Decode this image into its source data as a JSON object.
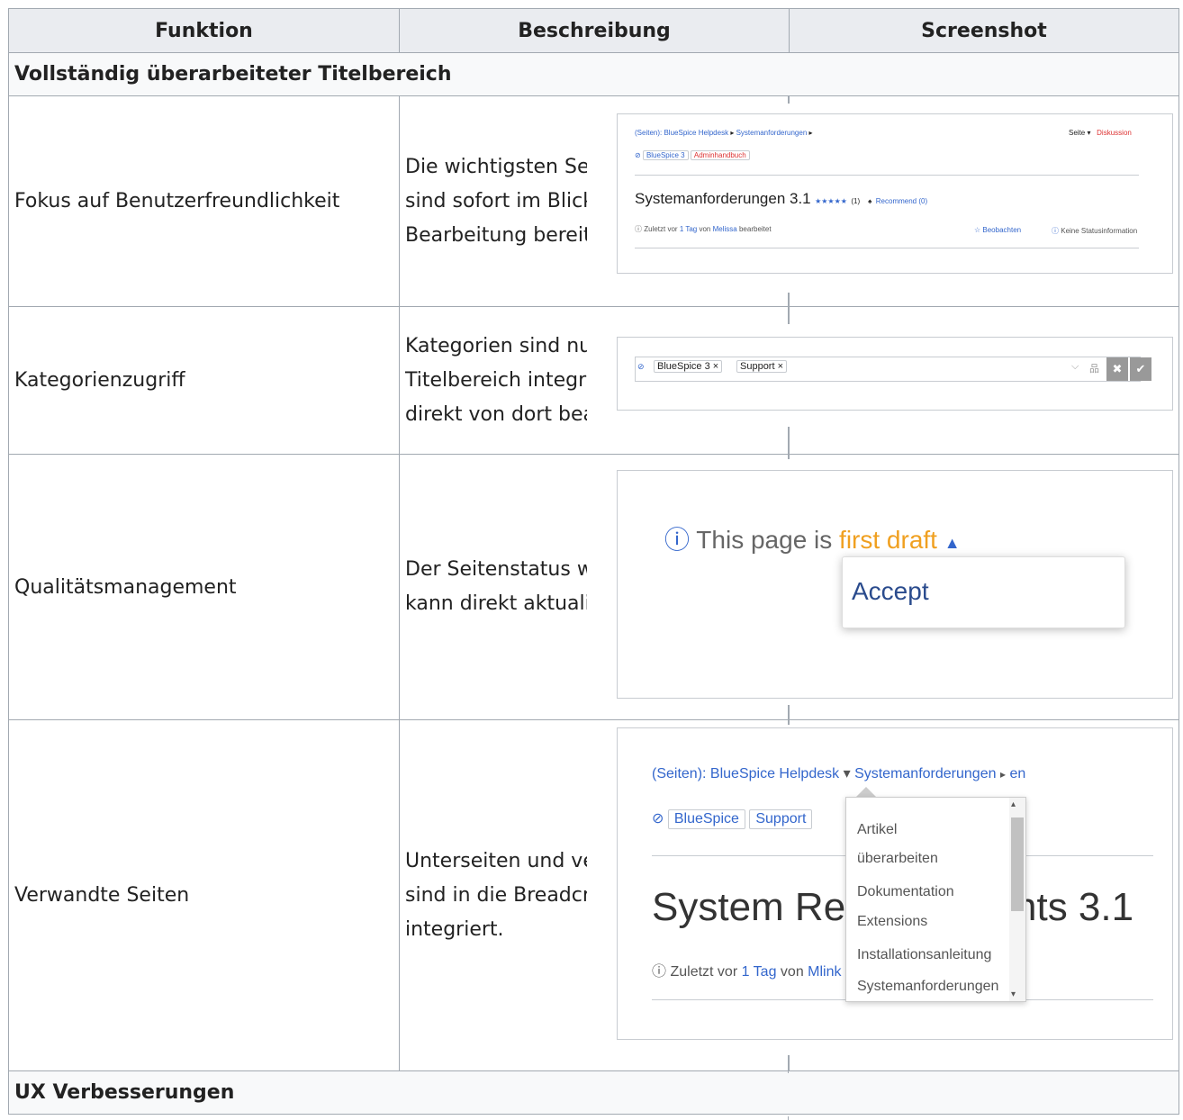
{
  "headers": {
    "function": "Funktion",
    "description": "Beschreibung",
    "screenshot": "Screenshot"
  },
  "sections": {
    "title": "Vollständig überarbeiteter Titelbereich",
    "ux": "UX Verbesserungen"
  },
  "rows": [
    {
      "function": "Fokus auf Benutzerfreundlichkeit",
      "description": "Die wichtigsten Seiteninformationen sind sofort im Blickfeld und zur Bearbeitung bereit."
    },
    {
      "function": "Kategorienzugriff",
      "description": "Kategorien sind nun in den Titelbereich integriert und können direkt von dort bearbeitet werden."
    },
    {
      "function": "Qualitätsmanagement",
      "description": "Der Seitenstatus wird angezeigt und kann direkt aktualisiert werden."
    },
    {
      "function": "Verwandte Seiten",
      "description": "Unterseiten und verwandte Seiten sind in die Breadcrumb Navigation integriert."
    }
  ],
  "shot1": {
    "breadcrumb_ns": "(Seiten):",
    "breadcrumb_1": "BlueSpice Helpdesk",
    "breadcrumb_2": "Systemanforderungen",
    "page_menu": "Seite",
    "discussion": "Diskussion",
    "tag_1": "BlueSpice 3",
    "tag_2": "Adminhandbuch",
    "title": "Systemanforderungen 3.1",
    "stars": "★★★★★",
    "rating_count": "(1)",
    "recommend": "Recommend (0)",
    "edited_prefix": "Zuletzt vor",
    "edited_time": "1 Tag",
    "edited_by": "von",
    "edited_user": "Melissa",
    "edited_suffix": "bearbeitet",
    "watch": "☆ Beobachten",
    "status": "Keine Statusinformation"
  },
  "shot2": {
    "chip_1": "BlueSpice 3",
    "chip_2": "Support"
  },
  "shot3": {
    "prefix": "This page is",
    "state": "first draft",
    "action": "Accept"
  },
  "shot4": {
    "breadcrumb_ns": "(Seiten):",
    "breadcrumb_1": "BlueSpice Helpdesk",
    "breadcrumb_2": "Systemanforderungen",
    "lang": "en",
    "tag_1": "BlueSpice",
    "tag_2": "Support",
    "title_left": "System Re",
    "title_right": "nts 3.1",
    "edited_prefix": "Zuletzt vor",
    "edited_time": "1 Tag",
    "edited_by": "von",
    "edited_user": "Mlink",
    "menu": [
      "Artikel",
      "überarbeiten",
      "Dokumentation",
      "Extensions",
      "Installationsanleitung",
      "Systemanforderungen"
    ]
  },
  "colors": {
    "accent": "#3366cc",
    "draft": "#f0a020",
    "border": "#a2a9b1",
    "header_bg": "#eaecf0"
  }
}
